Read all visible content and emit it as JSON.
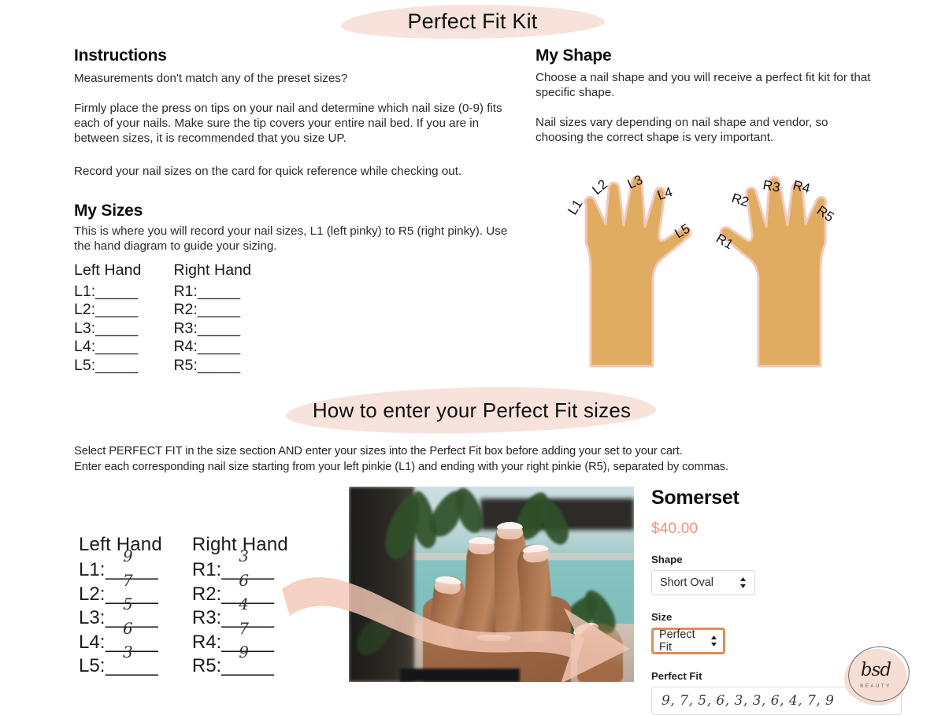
{
  "banners": {
    "top_title": "Perfect Fit Kit",
    "mid_title": "How to enter your Perfect Fit sizes"
  },
  "instructions": {
    "heading": "Instructions",
    "p1": "Measurements don't match any of the preset sizes?",
    "p2": "Firmly place the press on tips on your nail and determine which nail size (0-9) fits each of your nails. Make sure the tip covers your entire nail bed.  If you are in between sizes, it is recommended that you size UP.",
    "p3": "Record your nail sizes on the card for quick reference while checking out."
  },
  "my_shape": {
    "heading": "My Shape",
    "p1": "Choose a nail shape and you will receive a perfect fit kit for that specific shape.",
    "p2": "Nail sizes vary depending on nail shape and vendor, so choosing the correct shape is very important."
  },
  "my_sizes": {
    "heading": "My Sizes",
    "p1": "This is where you will record your nail sizes, L1 (left pinky) to R5 (right pinky). Use the hand diagram to guide your sizing.",
    "left_head": "Left Hand",
    "right_head": "Right Hand",
    "blank": "_____",
    "left_labels": [
      "L1:",
      "L2:",
      "L3:",
      "L4:",
      "L5:"
    ],
    "right_labels": [
      "R1:",
      "R2:",
      "R3:",
      "R4:",
      "R5:"
    ]
  },
  "hand_diagram": {
    "left_labels": [
      "L1",
      "L2",
      "L3",
      "L4",
      "L5"
    ],
    "right_labels": [
      "R1",
      "R2",
      "R3",
      "R4",
      "R5"
    ],
    "hand_color": "#E0AC62",
    "outline_color": "#F3C9B9"
  },
  "how_to": {
    "line1": "Select PERFECT FIT in the size section AND enter your sizes into the Perfect Fit  box before adding your set to your cart.",
    "line2": "Enter each corresponding nail size starting from your left pinkie (L1) and ending with your right pinkie (R5), separated by commas."
  },
  "filled_sizes": {
    "left_head": "Left Hand",
    "right_head": "Right Hand",
    "blank": "_____",
    "left": [
      {
        "label": "L1:",
        "value": "9"
      },
      {
        "label": "L2:",
        "value": "7"
      },
      {
        "label": "L3:",
        "value": "5"
      },
      {
        "label": "L4:",
        "value": "6"
      },
      {
        "label": "L5:",
        "value": "3"
      }
    ],
    "right": [
      {
        "label": "R1:",
        "value": "3"
      },
      {
        "label": "R2:",
        "value": "6"
      },
      {
        "label": "R3:",
        "value": "4"
      },
      {
        "label": "R4:",
        "value": "7"
      },
      {
        "label": "R5:",
        "value": "9"
      }
    ]
  },
  "product": {
    "title": "Somerset",
    "price": "$40.00",
    "price_color": "#F0927A",
    "shape_label": "Shape",
    "shape_value": "Short Oval",
    "size_label": "Size",
    "size_value": "Perfect Fit",
    "size_focus_color": "#E08A5A",
    "perfect_fit_label": "Perfect Fit",
    "perfect_fit_value": "9, 7, 5, 6, 3, 3, 6, 4, 7, 9"
  },
  "logo": {
    "mark": "bsd",
    "sub": "BEAUTY",
    "blob_color": "#F7DED4"
  },
  "theme": {
    "highlight": "#F7E3DC",
    "arrow": "#F3C7B4"
  }
}
